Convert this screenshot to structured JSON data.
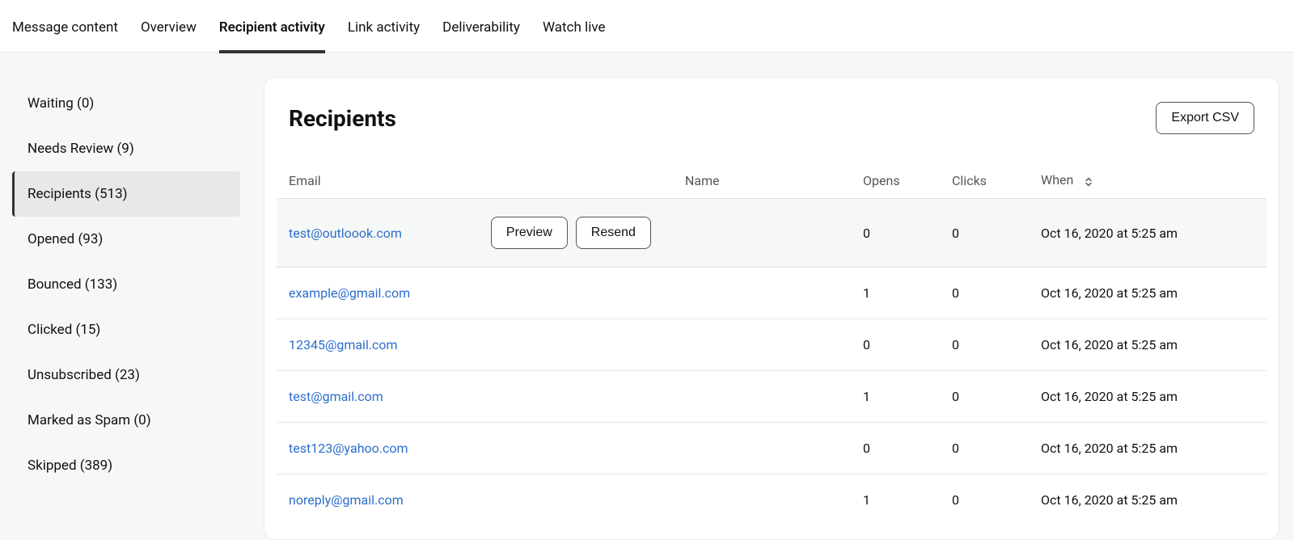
{
  "tabs": [
    {
      "label": "Message content",
      "active": false
    },
    {
      "label": "Overview",
      "active": false
    },
    {
      "label": "Recipient activity",
      "active": true
    },
    {
      "label": "Link activity",
      "active": false
    },
    {
      "label": "Deliverability",
      "active": false
    },
    {
      "label": "Watch live",
      "active": false
    }
  ],
  "sidebar": [
    {
      "label": "Waiting (0)",
      "active": false
    },
    {
      "label": "Needs Review (9)",
      "active": false
    },
    {
      "label": "Recipients (513)",
      "active": true
    },
    {
      "label": "Opened (93)",
      "active": false
    },
    {
      "label": "Bounced (133)",
      "active": false
    },
    {
      "label": "Clicked (15)",
      "active": false
    },
    {
      "label": "Unsubscribed (23)",
      "active": false
    },
    {
      "label": "Marked as Spam (0)",
      "active": false
    },
    {
      "label": "Skipped (389)",
      "active": false
    }
  ],
  "panel": {
    "title": "Recipients",
    "export_label": "Export CSV",
    "columns": {
      "email": "Email",
      "name": "Name",
      "opens": "Opens",
      "clicks": "Clicks",
      "when": "When"
    },
    "row_buttons": {
      "preview": "Preview",
      "resend": "Resend"
    },
    "rows": [
      {
        "email": "test@outloook.com",
        "name": "",
        "opens": "0",
        "clicks": "0",
        "when": "Oct 16, 2020 at 5:25 am",
        "hovered": true
      },
      {
        "email": "example@gmail.com",
        "name": "",
        "opens": "1",
        "clicks": "0",
        "when": "Oct 16, 2020 at 5:25 am",
        "hovered": false
      },
      {
        "email": "12345@gmail.com",
        "name": "",
        "opens": "0",
        "clicks": "0",
        "when": "Oct 16, 2020 at 5:25 am",
        "hovered": false
      },
      {
        "email": "test@gmail.com",
        "name": "",
        "opens": "1",
        "clicks": "0",
        "when": "Oct 16, 2020 at 5:25 am",
        "hovered": false
      },
      {
        "email": "test123@yahoo.com",
        "name": "",
        "opens": "0",
        "clicks": "0",
        "when": "Oct 16, 2020 at 5:25 am",
        "hovered": false
      },
      {
        "email": "noreply@gmail.com",
        "name": "",
        "opens": "1",
        "clicks": "0",
        "when": "Oct 16, 2020 at 5:25 am",
        "hovered": false
      }
    ]
  }
}
